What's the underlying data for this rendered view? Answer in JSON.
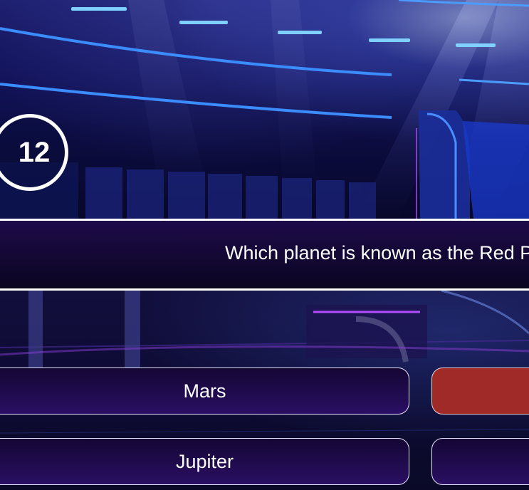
{
  "timer": {
    "value": "12"
  },
  "question": {
    "text": "Which planet is known as the Red Planet?"
  },
  "answers": [
    {
      "label": "Mars"
    },
    {
      "label": ""
    },
    {
      "label": "Jupiter"
    },
    {
      "label": ""
    }
  ],
  "colors": {
    "selected_answer": "#a02a28",
    "answer_bg": "#1e0a48",
    "question_bg": "#120730",
    "timer_ring": "#ffffff"
  }
}
